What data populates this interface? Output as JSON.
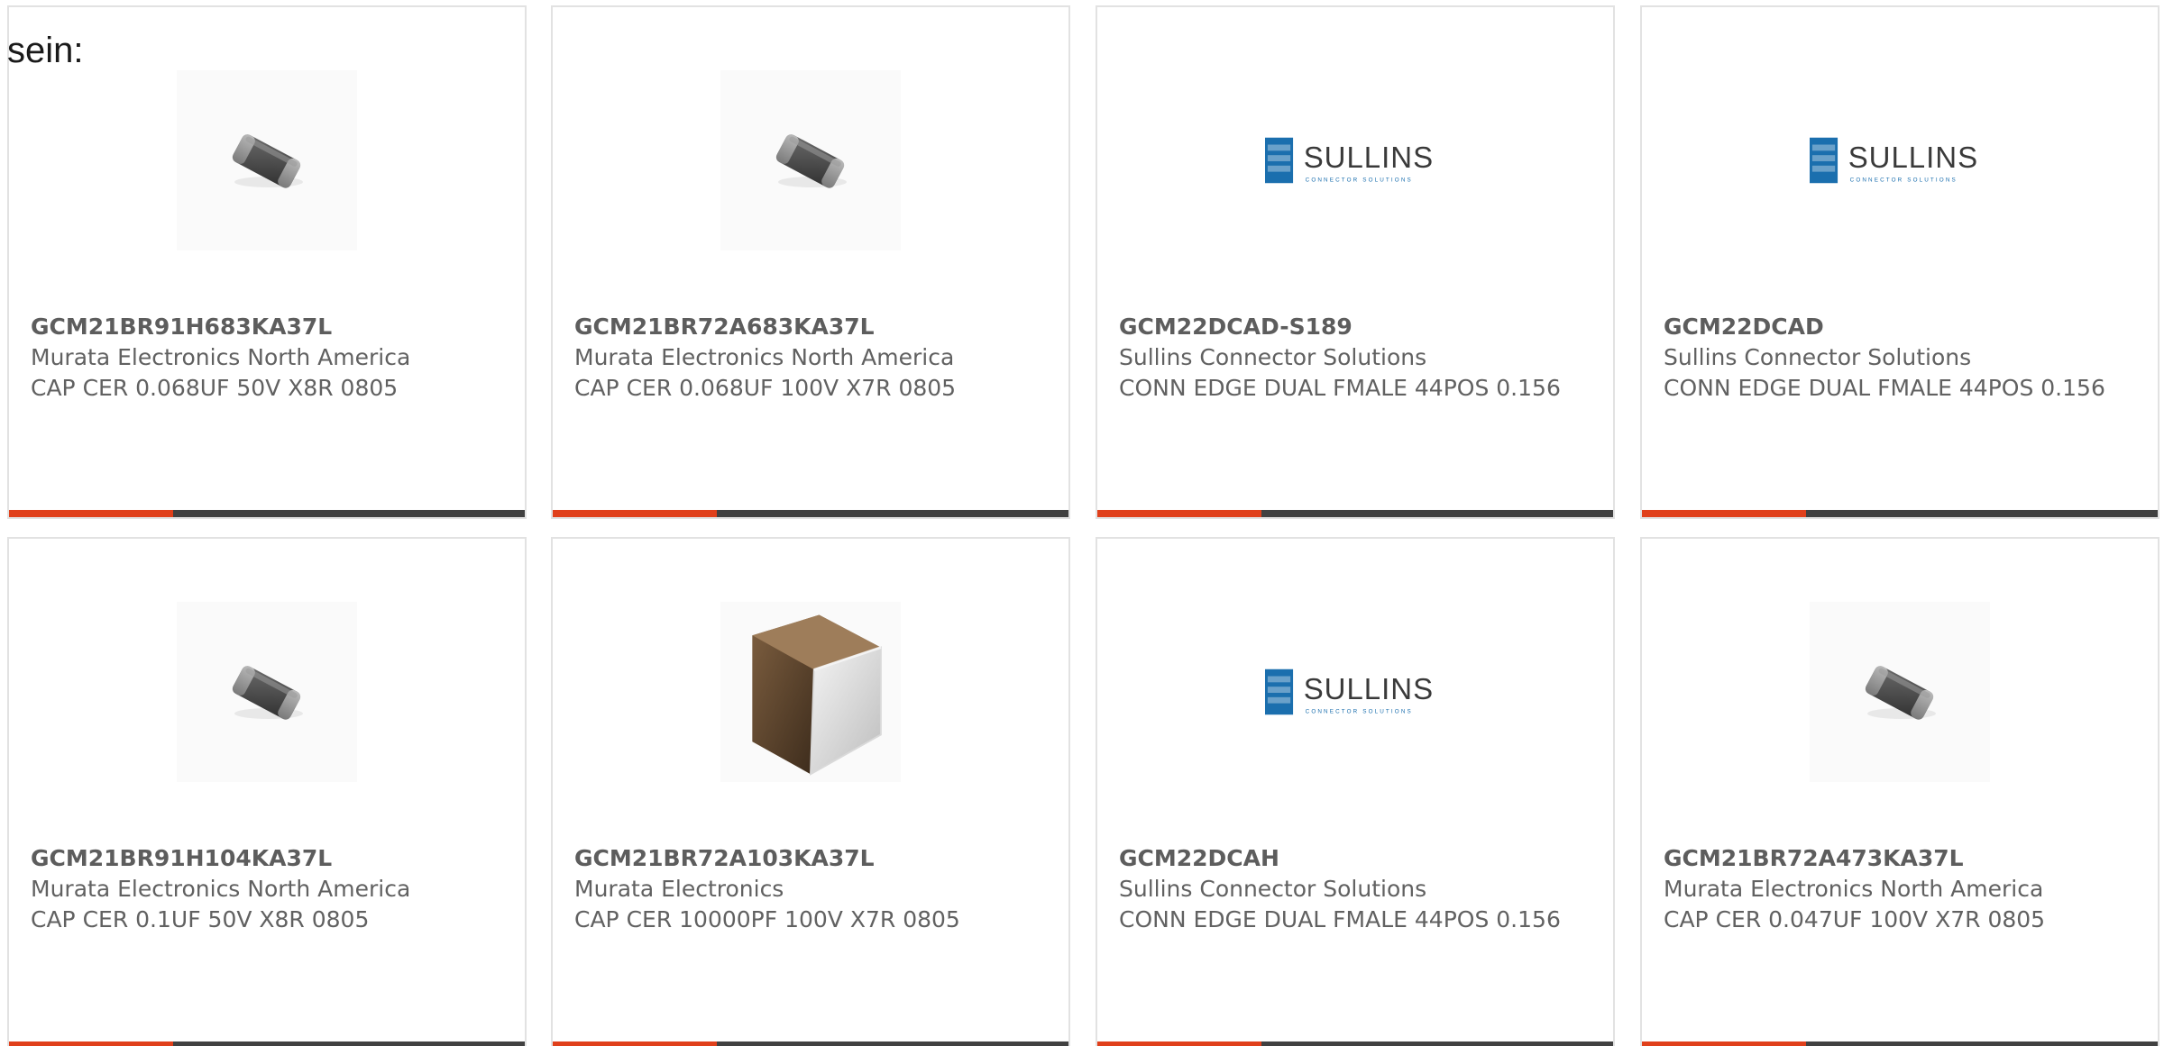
{
  "page": {
    "prefix_text": "sein:"
  },
  "colors": {
    "accent_bar": "#e0401b",
    "base_bar": "#414141",
    "card_border": "#e2e2e2",
    "text": "#616161",
    "sullins_blue": "#1b6fae"
  },
  "cards": [
    {
      "part_number": "GCM21BR91H683KA37L",
      "manufacturer": "Murata Electronics North America",
      "description": "CAP CER 0.068UF 50V X8R 0805",
      "image": "chip-capacitor-icon"
    },
    {
      "part_number": "GCM21BR72A683KA37L",
      "manufacturer": "Murata Electronics North America",
      "description": "CAP CER 0.068UF 100V X7R 0805",
      "image": "chip-capacitor-icon"
    },
    {
      "part_number": "GCM22DCAD-S189",
      "manufacturer": "Sullins Connector Solutions",
      "description": "CONN EDGE DUAL FMALE 44POS 0.156",
      "image": "sullins-logo",
      "logo_text": "SULLINS",
      "logo_tagline": "CONNECTOR SOLUTIONS"
    },
    {
      "part_number": "GCM22DCAD",
      "manufacturer": "Sullins Connector Solutions",
      "description": "CONN EDGE DUAL FMALE 44POS 0.156",
      "image": "sullins-logo",
      "logo_text": "SULLINS",
      "logo_tagline": "CONNECTOR SOLUTIONS"
    },
    {
      "part_number": "GCM21BR91H104KA37L",
      "manufacturer": "Murata Electronics North America",
      "description": "CAP CER 0.1UF 50V X8R 0805",
      "image": "chip-capacitor-icon"
    },
    {
      "part_number": "GCM21BR72A103KA37L",
      "manufacturer": "Murata Electronics",
      "description": "CAP CER 10000PF 100V X7R 0805",
      "image": "large-capacitor-icon"
    },
    {
      "part_number": "GCM22DCAH",
      "manufacturer": "Sullins Connector Solutions",
      "description": "CONN EDGE DUAL FMALE 44POS 0.156",
      "image": "sullins-logo",
      "logo_text": "SULLINS",
      "logo_tagline": "CONNECTOR SOLUTIONS"
    },
    {
      "part_number": "GCM21BR72A473KA37L",
      "manufacturer": "Murata Electronics North America",
      "description": "CAP CER 0.047UF 100V X7R 0805",
      "image": "chip-capacitor-icon"
    }
  ]
}
